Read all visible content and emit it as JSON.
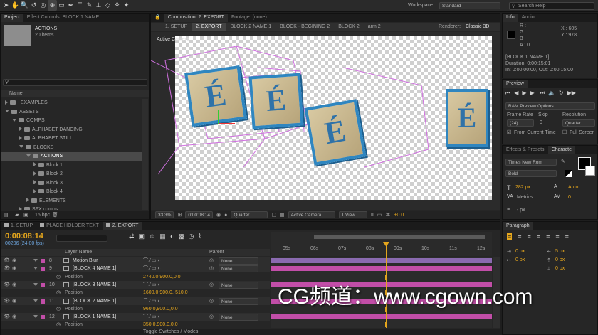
{
  "toolbar": {
    "workspace_label": "Workspace:",
    "workspace_value": "Standard",
    "search_placeholder": "Search Help"
  },
  "project": {
    "tabs": [
      "Project",
      "Effect Controls: BLOCK 1 NAME"
    ],
    "selected_name": "ACTIONS",
    "selected_count": "20 items",
    "column_name": "Name",
    "tree": [
      {
        "label": "_EXAMPLES",
        "depth": 0,
        "open": false
      },
      {
        "label": "ASSETS",
        "depth": 0,
        "open": true
      },
      {
        "label": "COMPS",
        "depth": 1,
        "open": true
      },
      {
        "label": "ALPHABET DANCING",
        "depth": 2,
        "open": false
      },
      {
        "label": "ALPHABET STILL",
        "depth": 2,
        "open": false
      },
      {
        "label": "BLOCKS",
        "depth": 2,
        "open": true
      },
      {
        "label": "ACTIONS",
        "depth": 3,
        "open": true,
        "selected": true
      },
      {
        "label": "Block 1",
        "depth": 4,
        "open": false
      },
      {
        "label": "Block 2",
        "depth": 4,
        "open": false
      },
      {
        "label": "Block 3",
        "depth": 4,
        "open": false
      },
      {
        "label": "Block 4",
        "depth": 4,
        "open": false
      },
      {
        "label": "ELEMENTS",
        "depth": 3,
        "open": false
      },
      {
        "label": "SFX comps",
        "depth": 2,
        "open": false
      }
    ],
    "bpc": "16 bpc"
  },
  "composition": {
    "tabs": [
      "Composition: 2. EXPORT",
      "Footage: (none)"
    ],
    "crumbs": [
      "1. SETUP",
      "2. EXPORT",
      "BLOCK 2 NAME 1",
      "BLOCK - BEGINING 2",
      "BLOCK 2",
      "arm 2"
    ],
    "renderer_label": "Renderer:",
    "renderer_value": "Classic 3D",
    "viewer_label": "Active Camera",
    "letter": "É",
    "footer": {
      "zoom": "33.3%",
      "time": "0:00:08:14",
      "resolution": "Quarter",
      "camera": "Active Camera",
      "views": "1 View",
      "exposure": "+0.0"
    }
  },
  "info": {
    "tabs": [
      "Info",
      "Audio"
    ],
    "r": "R :",
    "g": "G :",
    "b": "B :",
    "a": "A : 0",
    "x": "X : 605",
    "y": "Y : 978",
    "layer": "[BLOCK 1 NAME 1]",
    "duration": "Duration: 0:00:15:01",
    "inout": "In: 0:00:00:00, Out: 0:00:15:00"
  },
  "preview": {
    "title": "Preview",
    "ram": "RAM Preview Options",
    "frame_rate_label": "Frame Rate",
    "frame_rate": "(24)",
    "skip_label": "Skip",
    "skip": "0",
    "resolution_label": "Resolution",
    "resolution": "Quarter",
    "from_current": "From Current Time",
    "full_screen": "Full Screen"
  },
  "character": {
    "tabs": [
      "Effects & Presets",
      "Characte"
    ],
    "font": "Times New Rom",
    "style": "Bold",
    "size": "282 px",
    "leading": "Auto",
    "metrics": "Metrics",
    "tracking": "0",
    "stroke": "- px"
  },
  "paragraph": {
    "title": "Paragraph",
    "indent1": "0 px",
    "indent2": "5 px",
    "indent3": "0 px",
    "space1": "0 px",
    "space2": "0 px"
  },
  "timeline": {
    "tabs": [
      "1. SETUP",
      "PLACE HOLDER TEXT",
      "2. EXPORT"
    ],
    "current_time": "0:00:08:14",
    "frame_info": "00206 (24.00 fps)",
    "col_layer": "Layer Name",
    "col_parent": "Parent",
    "ruler": [
      "05s",
      "06s",
      "07s",
      "08s",
      "09s",
      "10s",
      "11s",
      "12s"
    ],
    "rows": [
      {
        "num": "8",
        "name": "Motion Blur",
        "parent": "None",
        "type": "layer"
      },
      {
        "num": "9",
        "name": "[BLOCK 4 NAME 1]",
        "parent": "None",
        "type": "layer"
      },
      {
        "num": "",
        "name": "Position",
        "value": "2740.0,900.0,0.0",
        "type": "prop"
      },
      {
        "num": "10",
        "name": "[BLOCK 3 NAME 1]",
        "parent": "None",
        "type": "layer"
      },
      {
        "num": "",
        "name": "Position",
        "value": "1600.0,900.0,-510.0",
        "type": "prop"
      },
      {
        "num": "11",
        "name": "[BLOCK 2 NAME 1]",
        "parent": "None",
        "type": "layer"
      },
      {
        "num": "",
        "name": "Position",
        "value": "960.0,900.0,0.0",
        "type": "prop"
      },
      {
        "num": "12",
        "name": "[BLOCK 1 NAME 1]",
        "parent": "None",
        "type": "layer"
      },
      {
        "num": "",
        "name": "Position",
        "value": "350.0,900.0,0.0",
        "type": "prop"
      }
    ],
    "toggle": "Toggle Switches / Modes"
  },
  "watermark": "CG频道：www.cgown.com"
}
